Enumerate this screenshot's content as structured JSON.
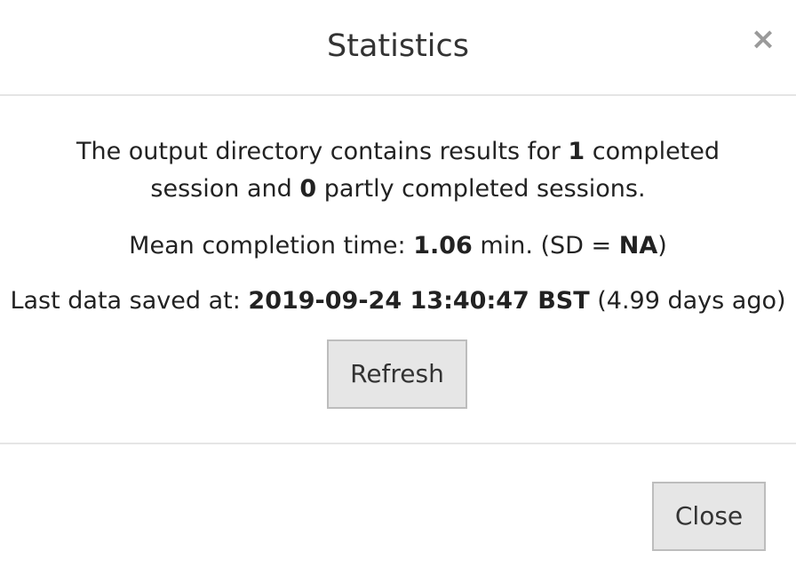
{
  "dialog": {
    "title": "Statistics",
    "close_icon": "×"
  },
  "stats": {
    "line1_prefix": "The output directory contains results for ",
    "completed_count": "1",
    "line1_mid": " completed session and ",
    "partly_count": "0",
    "line1_suffix": " partly completed sessions.",
    "mean_prefix": "Mean completion time: ",
    "mean_value": "1.06",
    "mean_mid": " min. (SD = ",
    "sd_value": "NA",
    "mean_suffix": ")",
    "saved_prefix": "Last data saved at: ",
    "saved_timestamp": "2019-09-24 13:40:47 BST",
    "saved_suffix": " (4.99 days ago)"
  },
  "buttons": {
    "refresh_label": "Refresh",
    "close_label": "Close"
  }
}
